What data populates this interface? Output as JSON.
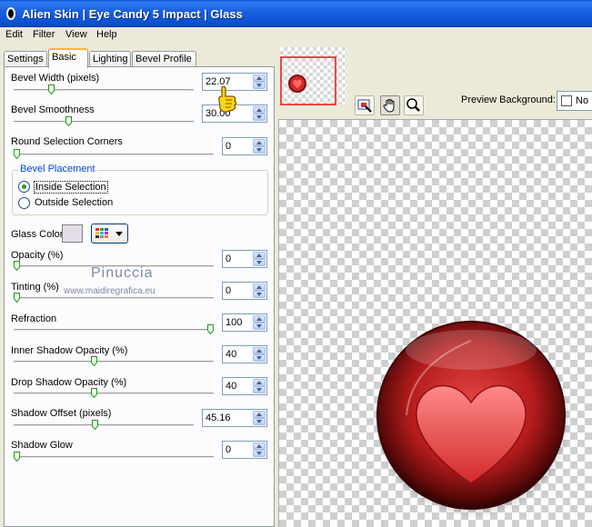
{
  "window": {
    "title": "Alien Skin | Eye Candy 5 Impact | Glass"
  },
  "menu": [
    "Edit",
    "Filter",
    "View",
    "Help"
  ],
  "tabs": [
    "Settings",
    "Basic",
    "Lighting",
    "Bevel Profile"
  ],
  "active_tab": "Basic",
  "controls": {
    "bevel_width": {
      "label": "Bevel Width (pixels)",
      "value": "22.07",
      "level": 0.2
    },
    "bevel_smoothness": {
      "label": "Bevel Smoothness",
      "value": "30.00",
      "level": 0.3
    },
    "round_corners": {
      "label": "Round Selection Corners",
      "value": "0",
      "level": 0
    },
    "opacity": {
      "label": "Opacity (%)",
      "value": "0",
      "level": 0
    },
    "tinting": {
      "label": "Tinting (%)",
      "value": "0",
      "level": 0
    },
    "refraction": {
      "label": "Refraction",
      "value": "100",
      "level": 1.0
    },
    "inner_shadow": {
      "label": "Inner Shadow Opacity (%)",
      "value": "40",
      "level": 0.4
    },
    "drop_shadow": {
      "label": "Drop Shadow Opacity (%)",
      "value": "40",
      "level": 0.4
    },
    "shadow_offset": {
      "label": "Shadow Offset (pixels)",
      "value": "45.16",
      "level": 0.45
    },
    "shadow_glow": {
      "label": "Shadow Glow",
      "value": "0",
      "level": 0
    }
  },
  "bevel_placement": {
    "title": "Bevel Placement",
    "options": [
      "Inside Selection",
      "Outside Selection"
    ],
    "selected": "Inside Selection"
  },
  "glass_color": {
    "label": "Glass Color",
    "color": "#e3dde8"
  },
  "watermark": {
    "name": "Pinuccia",
    "url": "www.maidiregrafica.eu"
  },
  "preview": {
    "background_label": "Preview Background:",
    "background_value": "No"
  },
  "colors": {
    "titlebar": "#0a4fd0",
    "accent_tab": "#f9b73b",
    "group_title": "#0046d5"
  },
  "icons": [
    "alien-skin-app-icon",
    "hand-pointer-icon",
    "navigate-icon",
    "hand-tool-icon",
    "zoom-icon"
  ]
}
